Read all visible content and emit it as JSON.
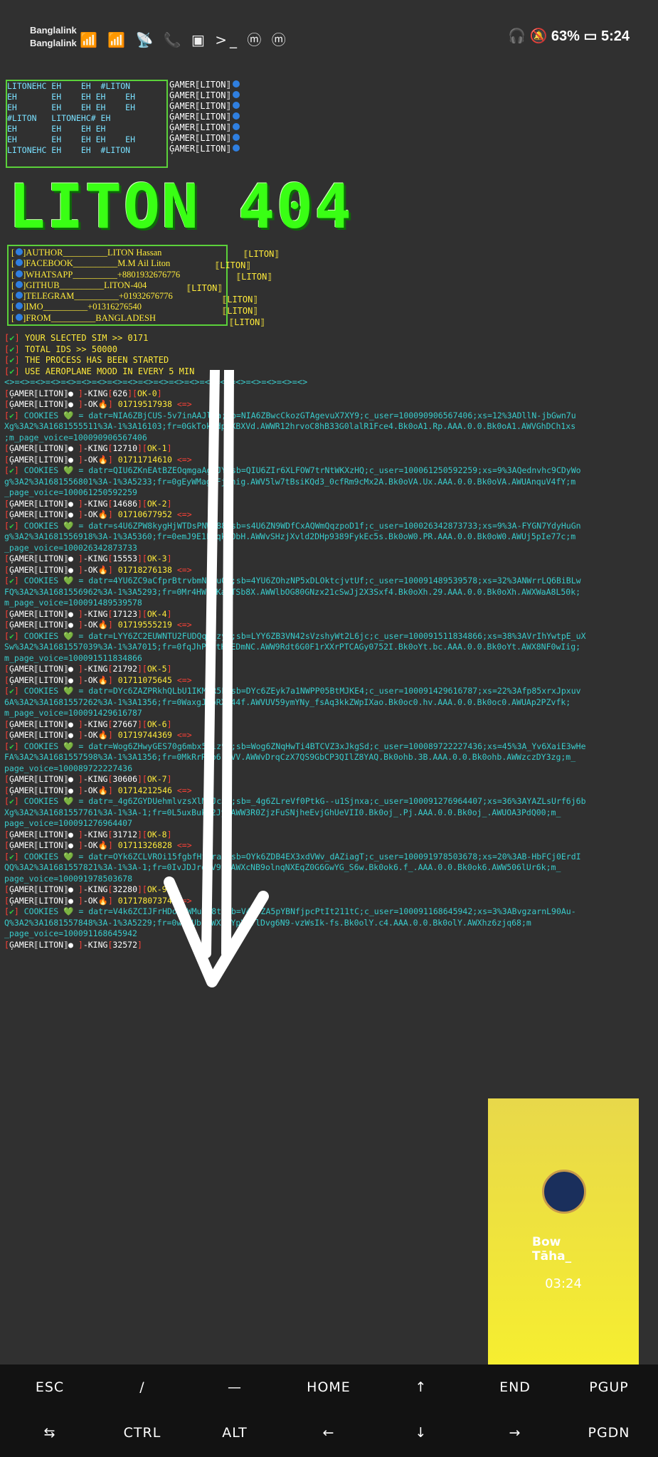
{
  "status_bar": {
    "carrier1": "Banglalink",
    "carrier2": "Banglalink",
    "left_icons": "📶 📶 📡 📞 ▣ >_ ⓜ ⓜ",
    "battery": "63%",
    "time": "5:24"
  },
  "banner": {
    "rows": [
      "LITONEHC EH    EH  #LITON",
      "EH       EH    EH EH    EH",
      "EH       EH    EH EH    EH",
      "#LITON   LITONEHC# EH",
      "EH       EH    EH EH",
      "EH       EH    EH EH    EH",
      "LITONEHC EH    EH  #LITON"
    ],
    "gamer_tag": "ĢAMER⟦LITON⟧"
  },
  "big_title": "LITON 404",
  "info": {
    "rows": [
      {
        "label": "AUTHOR",
        "value": "LITON Hassan"
      },
      {
        "label": "FACEBOOK",
        "value": "M.M Ail Liton"
      },
      {
        "label": "WHATSAPP",
        "value": "+8801932676776"
      },
      {
        "label": "GITHUB",
        "value": "LITON-404"
      },
      {
        "label": "TELEGRAM",
        "value": "+01932676776"
      },
      {
        "label": "IMO",
        "value": "+01316276540"
      },
      {
        "label": "FROM",
        "value": "BANGLADESH"
      }
    ],
    "tag": "⟦LITON⟧"
  },
  "status_lines": [
    "YOUR SLECTED SIM >> 0171",
    "TOTAL IDS >> 50000",
    "THE PROCESS HAS BEEN STARTED",
    "USE AEROPLANE MOOD IN EVERY 5 MIN"
  ],
  "separator": "<>=<>=<>=<>=<>=<>=<>=<>=<>=<>=<>=<>=<>=<>=<>=<>=<>=<>=<>=<>",
  "log": [
    {
      "king": "626",
      "ok": "OK-0",
      "num": "01719517938",
      "cookie": "datr=NIA6ZBjCUS-5v7inAAJlia;sb=NIA6ZBwcCkozGTAgevuX7XY9;c_user=100090906567406;xs=12%3ADllN-jbGwn7u",
      "cont": "Xg%3A2%3A1681555511%3A-1%3A16103;fr=0GkTokGdp7XBXVd.AWWR12hrvoC8hB33G0lalR1Fce4.Bk0oA1.Rp.AAA.0.0.Bk0oA1.AWVGhDCh1xs",
      "voice": ";m_page_voice=100090906567406"
    },
    {
      "king": "12710",
      "ok": "OK-1",
      "num": "01711714610",
      "cookie": "datr=QIU6ZKnEAtBZEOqmgaAg6JY;sb=QIU6ZIr6XLFOW7trNtWKXzHQ;c_user=100061250592259;xs=9%3AQednvhc9CDyWo",
      "cont": "g%3A2%3A1681556801%3A-1%3A5233;fr=0gEyWMagqFj2nig.AWV5lw7tBsiKQd3_0cfRm9cMx2A.Bk0oVA.Ux.AAA.0.0.Bk0oVA.AWUAnquV4fY;m",
      "voice": "_page_voice=100061250592259"
    },
    {
      "king": "14686",
      "ok": "OK-2",
      "num": "01710677952",
      "cookie": "datr=s4U6ZPW8kygHjWTDsPNWC88;sb=s4U6ZN9WDfCxAQWmQqzpoD1f;c_user=100026342873733;xs=9%3A-FYGN7YdyHuGn",
      "cont": "g%3A2%3A1681556918%3A-1%3A5360;fr=0emJ9E1Lnqk0ObH.AWWvSHzjXvld2DHp9389FykEc5s.Bk0oW0.PR.AAA.0.0.Bk0oW0.AWUj5pIe77c;m",
      "voice": "_page_voice=100026342873733"
    },
    {
      "king": "15553",
      "ok": "OK-3",
      "num": "01718276138",
      "cookie": "datr=4YU6ZC9aCfprBtrvbmNzgu0M;sb=4YU6ZOhzNP5xDLOktcjvtUf;c_user=100091489539578;xs=32%3ANWrrLQ6BiBLw",
      "cont": "FQ%3A2%3A1681556962%3A-1%3A5293;fr=0Mr4HW1GKaMTSb8X.AWWlbOG80GNzx21cSwJj2X3Sxf4.Bk0oXh.29.AAA.0.0.Bk0oXh.AWXWaA8L50k;",
      "voice": "m_page_voice=100091489539578"
    },
    {
      "king": "17123",
      "ok": "OK-4",
      "num": "01719555219",
      "cookie": "datr=LYY6ZC2EUWNTU2FUDQqf_zyy;sb=LYY6ZB3VN42sVzshyWt2L6jc;c_user=100091511834866;xs=38%3AVrIhYwtpE_uX",
      "cont": "Sw%3A2%3A1681557039%3A-1%3A7015;fr=0fqJhPvQtHFEDmNC.AWW9Rdt6G0F1rXXrPTCAGy0752I.Bk0oYt.bc.AAA.0.0.Bk0oYt.AWX8NF0wIig;",
      "voice": "m_page_voice=100091511834866"
    },
    {
      "king": "21792",
      "ok": "OK-5",
      "num": "01711075645",
      "cookie": "datr=DYc6ZAZPRkhQLbU1IKMkR5F;sb=DYc6ZEyk7a1NWPP05BtMJKE4;c_user=100091429616787;xs=22%3Afp85xrxJpxuv",
      "cont": "6A%3A2%3A1681557262%3A-1%3A1356;fr=0WaxgJUpRXI44f.AWVUV59ymYNy_fsAq3kkZWpIXao.Bk0oc0.hv.AAA.0.0.Bk0oc0.AWUAp2PZvfk;",
      "voice": "m_page_voice=100091429616787"
    },
    {
      "king": "27667",
      "ok": "OK-6",
      "num": "01719744369",
      "cookie": "datr=Wog6ZHwyGES70g6mbx5kiz9S;sb=Wog6ZNqHwTi4BTCVZ3xJkgSd;c_user=100089722227436;xs=45%3A_Yv6XaiE3wHe",
      "cont": "FA%3A2%3A1681557598%3A-1%3A1356;fr=0MkRrRCb6raVV.AWWvDrqCzX7QS9GbCP3QIlZ8YAQ.Bk0ohb.3B.AAA.0.0.Bk0ohb.AWWzczDY3zg;m_",
      "voice": "page_voice=100089722227436"
    },
    {
      "king": "30606",
      "ok": "OK-7",
      "num": "01714212546",
      "cookie": "datr=_4g6ZGYDUehmlvzsXlMqJcJq;sb=_4g6ZLreVf0PtkG--u1Sjnxa;c_user=100091276964407;xs=36%3AYAZLsUrf6j6b",
      "cont": "Xg%3A2%3A1681557761%3A-1%3A-1;fr=0L5uxBuki2Jy.AWW3R0ZjzFuSNjheEvjGhUeVII0.Bk0oj_.Pj.AAA.0.0.Bk0oj_.AWUOA3PdQ00;m_",
      "voice": "page_voice=100091276964407"
    },
    {
      "king": "31712",
      "ok": "OK-8",
      "num": "01711326828",
      "cookie": "datr=OYk6ZCLVROi15fgbfHfIraJ;sb=OYk6ZDB4EX3xdVWv_dAZiagT;c_user=100091978503678;xs=20%3AB-HbFCj0ErdI",
      "cont": "QQ%3A2%3A1681557821%3A-1%3A-1;fr=0IvJDJrogV9S.AWXcNB9olnqNXEqZ0G6GwYG_S6w.Bk0ok6.f_.AAA.0.0.Bk0ok6.AWW506lUr6k;m_",
      "voice": "page_voice=100091978503678"
    },
    {
      "king": "32280",
      "ok": "OK-9",
      "num": "01717807374",
      "cookie": "datr=V4k6ZCIJFrHDojzWMuT98t;sb=V4k6ZA5pYBNfjpcPtIt211tC;c_user=100091168645942;xs=3%3ABvgzarnL90Au-",
      "cont": "Q%3A2%3A1681557848%3A-1%3A5229;fr=0w9zUb.AWXhxYpVd7lDvg6N9-vzWsIk-fs.Bk0olY.c4.AAA.0.0.Bk0olY.AWXhz6zjq68;m",
      "voice": "_page_voice=100091168645942"
    }
  ],
  "last_king": "32572",
  "pip": {
    "name_line1": "Bow",
    "name_line2": "Tāha_",
    "time": "03:24"
  },
  "keys_row1": [
    "ESC",
    "/",
    "—",
    "HOME",
    "↑",
    "END",
    "PGUP"
  ],
  "keys_row2": [
    "⇆",
    "CTRL",
    "ALT",
    "←",
    "↓",
    "→",
    "PGDN"
  ]
}
